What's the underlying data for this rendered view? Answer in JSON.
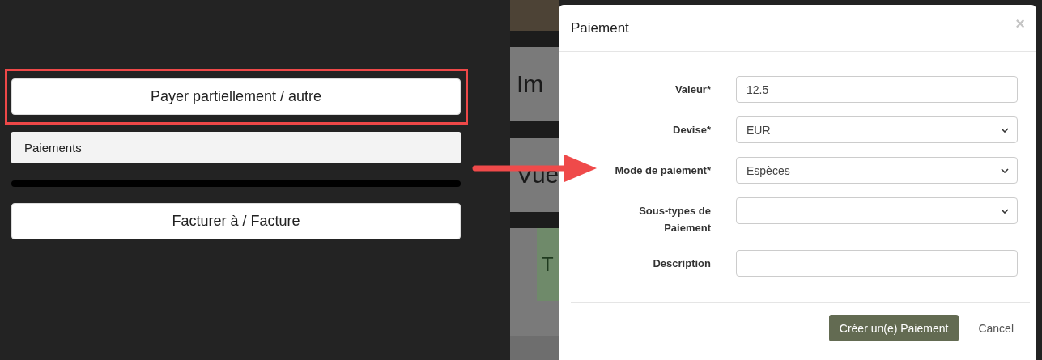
{
  "left_panel": {
    "pay_button": {
      "label": "Payer partiellement / autre",
      "highlighted": true
    },
    "payments_header": "Paiements",
    "invoice_button": "Facturer à / Facture"
  },
  "background_page": {
    "heading_1": "Im",
    "heading_2": "Vue",
    "card_text": "T"
  },
  "modal": {
    "title": "Paiement",
    "close": "×",
    "fields": [
      {
        "kind": "input",
        "label": "Valeur*",
        "value": "12.5"
      },
      {
        "kind": "select",
        "label": "Devise*",
        "value": "EUR"
      },
      {
        "kind": "select",
        "label": "Mode de paiement*",
        "value": "Espèces"
      },
      {
        "kind": "select",
        "label": "Sous-types de Paiement"
      },
      {
        "kind": "input",
        "label": "Description"
      }
    ],
    "buttons": [
      {
        "kind": "primary",
        "label": "Créer un(e) Paiement"
      },
      {
        "kind": "link",
        "label": "Cancel"
      }
    ]
  }
}
